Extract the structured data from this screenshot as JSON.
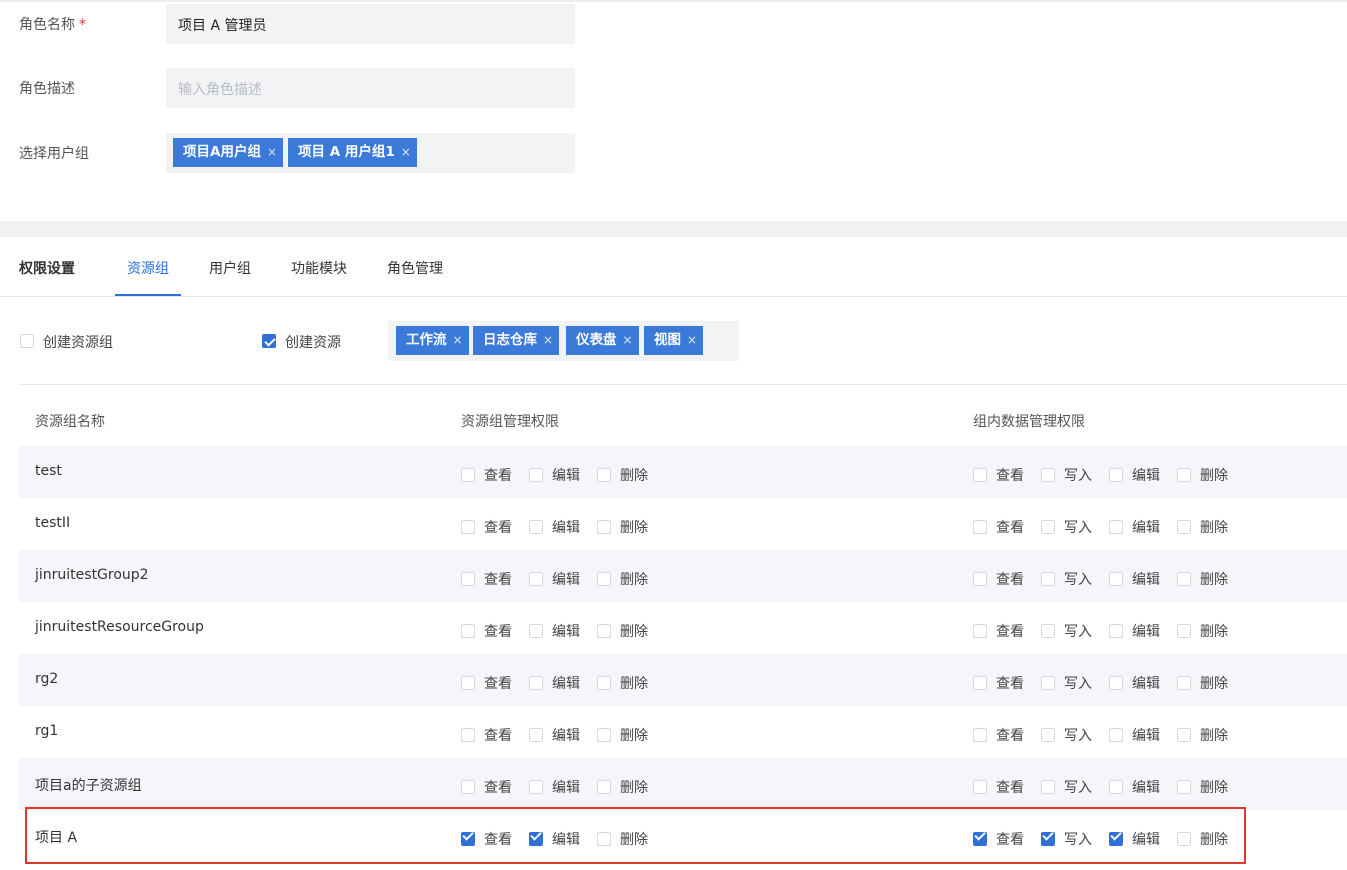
{
  "form": {
    "role_name_label": "角色名称",
    "required_mark": "*",
    "role_name_value": "项目 A 管理员",
    "role_desc_label": "角色描述",
    "role_desc_placeholder": "输入角色描述",
    "user_group_label": "选择用户组",
    "user_groups": [
      "项目A用户组",
      "项目 A 用户组1"
    ]
  },
  "permissions": {
    "section_title": "权限设置",
    "tabs": [
      "资源组",
      "用户组",
      "功能模块",
      "角色管理"
    ],
    "active_tab": "资源组",
    "create_group_label": "创建资源组",
    "create_group_checked": false,
    "create_resource_label": "创建资源",
    "create_resource_checked": true,
    "resource_types": [
      "工作流",
      "日志仓库",
      "仪表盘",
      "视图"
    ]
  },
  "table": {
    "headers": [
      "资源组名称",
      "资源组管理权限",
      "组内数据管理权限"
    ],
    "group_perm_labels": [
      "查看",
      "编辑",
      "删除"
    ],
    "data_perm_labels": [
      "查看",
      "写入",
      "编辑",
      "删除"
    ],
    "rows": [
      {
        "name": "test",
        "group": [
          false,
          false,
          false
        ],
        "data": [
          false,
          false,
          false,
          false
        ]
      },
      {
        "name": "testII",
        "group": [
          false,
          false,
          false
        ],
        "data": [
          false,
          false,
          false,
          false
        ]
      },
      {
        "name": "jinruitestGroup2",
        "group": [
          false,
          false,
          false
        ],
        "data": [
          false,
          false,
          false,
          false
        ]
      },
      {
        "name": "jinruitestResourceGroup",
        "group": [
          false,
          false,
          false
        ],
        "data": [
          false,
          false,
          false,
          false
        ]
      },
      {
        "name": "rg2",
        "group": [
          false,
          false,
          false
        ],
        "data": [
          false,
          false,
          false,
          false
        ]
      },
      {
        "name": "rg1",
        "group": [
          false,
          false,
          false
        ],
        "data": [
          false,
          false,
          false,
          false
        ]
      },
      {
        "name": "项目a的子资源组",
        "group": [
          false,
          false,
          false
        ],
        "data": [
          false,
          false,
          false,
          false
        ]
      },
      {
        "name": "项目 A",
        "group": [
          true,
          true,
          false
        ],
        "data": [
          true,
          true,
          true,
          false
        ]
      }
    ]
  },
  "colors": {
    "accent": "#2f6fd6",
    "tag": "#3b7ad9",
    "highlight": "#e0392a"
  },
  "icons": {
    "tag_close": "×"
  }
}
